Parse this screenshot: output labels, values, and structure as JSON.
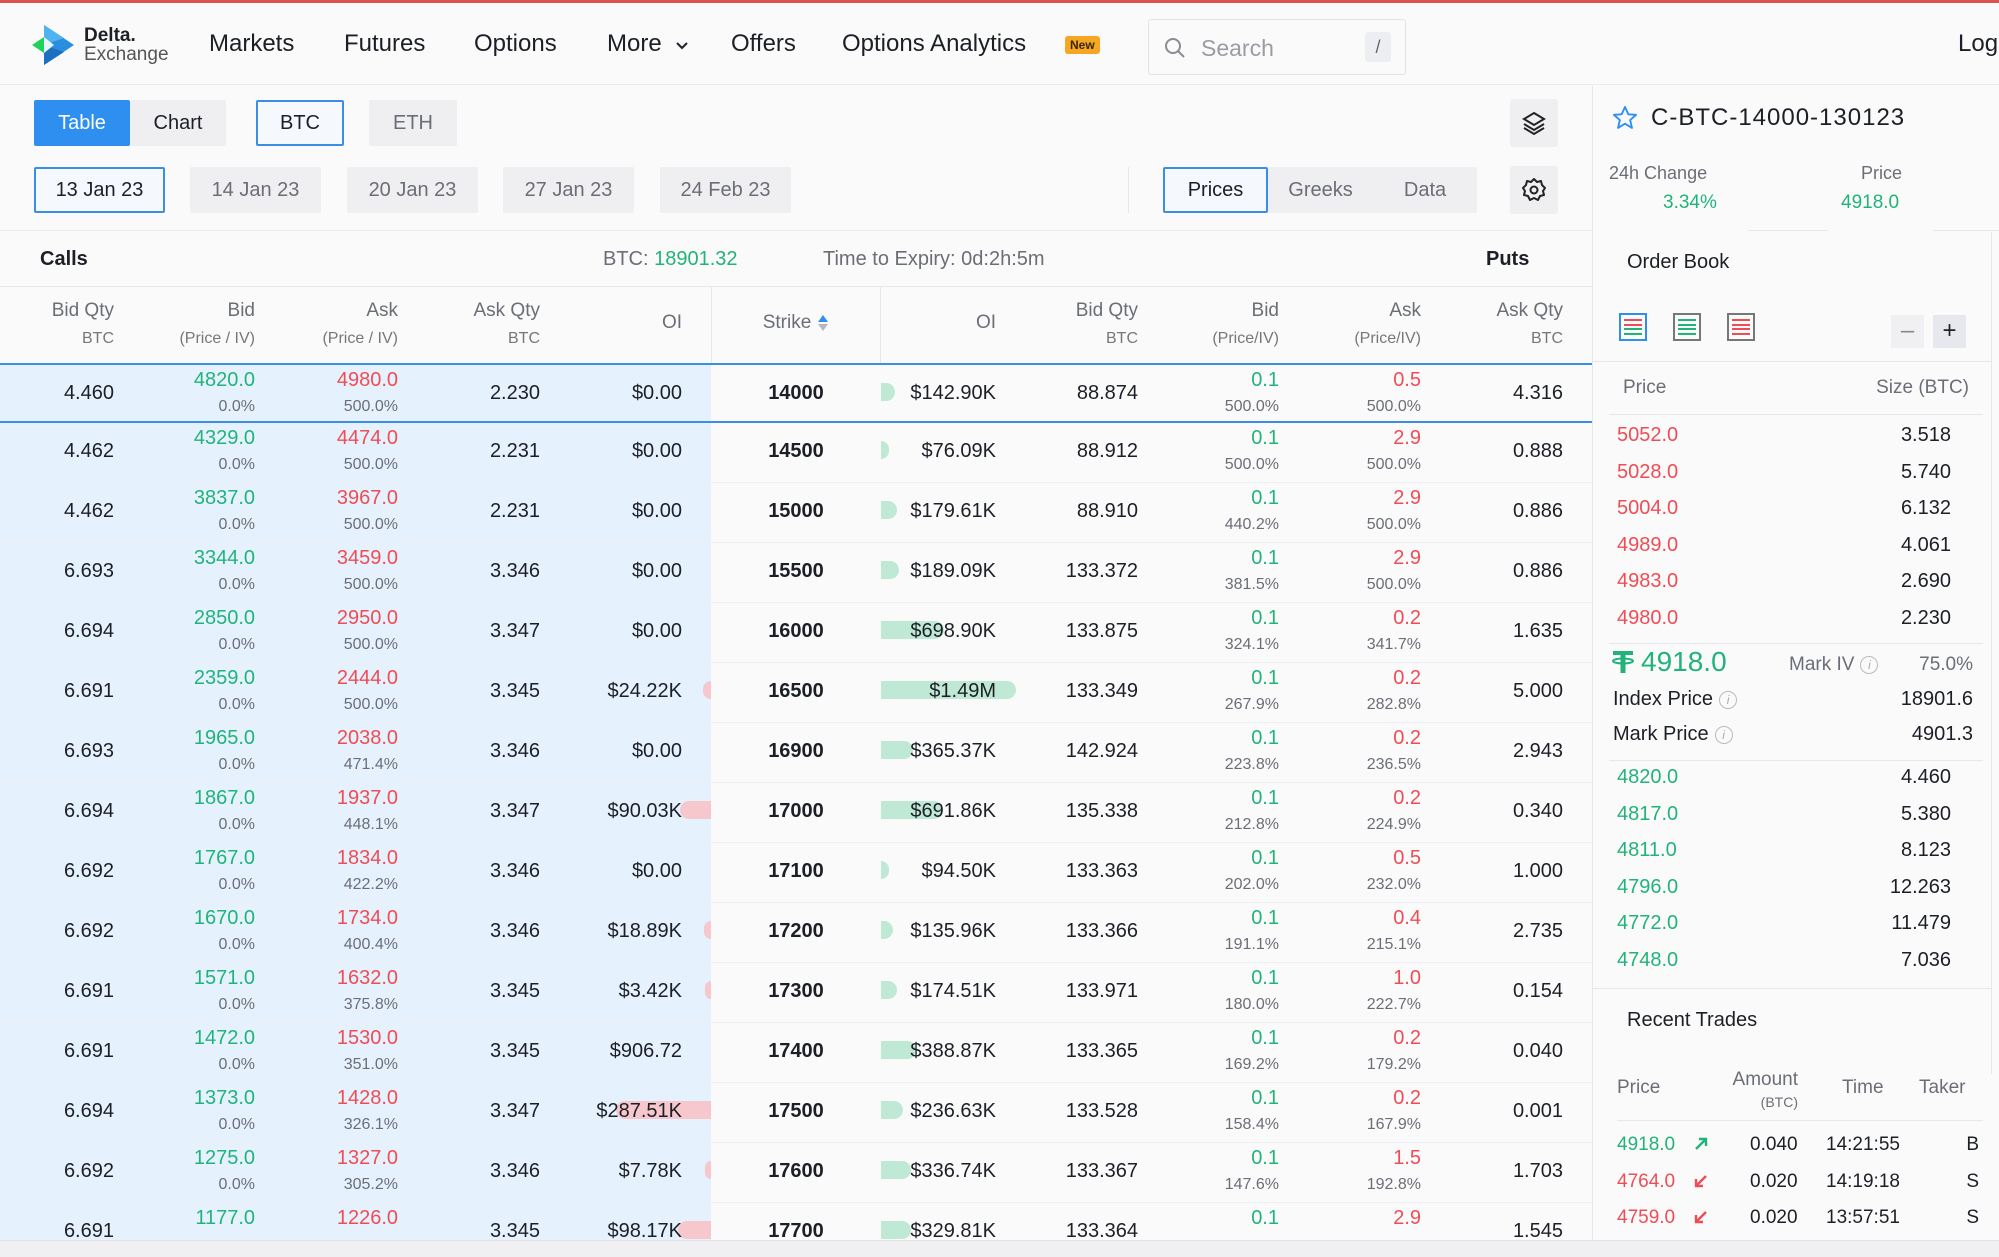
{
  "nav": {
    "brand_line1": "Delta.",
    "brand_line2": "Exchange",
    "items": [
      "Markets",
      "Futures",
      "Options",
      "More",
      "Offers",
      "Options Analytics"
    ],
    "new_badge": "New",
    "search_placeholder": "Search",
    "search_shortcut": "/",
    "login": "Log"
  },
  "toolbar": {
    "view_tabs": [
      "Table",
      "Chart"
    ],
    "assets": [
      "BTC",
      "ETH"
    ],
    "expiries": [
      "13 Jan 23",
      "14 Jan 23",
      "20 Jan 23",
      "27 Jan 23",
      "24 Feb 23"
    ],
    "modes": [
      "Prices",
      "Greeks",
      "Data"
    ]
  },
  "chain": {
    "calls_label": "Calls",
    "puts_label": "Puts",
    "btc_label": "BTC:",
    "btc_price": "18901.32",
    "expiry_label": "Time to Expiry: 0d:2h:5m",
    "headers_calls": [
      {
        "title": "Bid Qty",
        "sub": "BTC"
      },
      {
        "title": "Bid",
        "sub": "(Price / IV)"
      },
      {
        "title": "Ask",
        "sub": "(Price / IV)"
      },
      {
        "title": "Ask Qty",
        "sub": "BTC"
      },
      {
        "title": "OI",
        "sub": ""
      }
    ],
    "strike_header": "Strike",
    "headers_puts": [
      {
        "title": "OI",
        "sub": ""
      },
      {
        "title": "Bid Qty",
        "sub": "BTC"
      },
      {
        "title": "Bid",
        "sub": "(Price/IV)"
      },
      {
        "title": "Ask",
        "sub": "(Price/IV)"
      },
      {
        "title": "Ask Qty",
        "sub": "BTC"
      }
    ],
    "rows": [
      {
        "c_bidqty": "4.460",
        "c_bid": "4820.0",
        "c_bidiv": "0.0%",
        "c_ask": "4980.0",
        "c_askiv": "500.0%",
        "c_askqty": "2.230",
        "c_oi": "$0.00",
        "c_oi_frac": 0,
        "strike": "14000",
        "p_oi": "$142.90K",
        "p_oi_frac": 0.1,
        "p_bidqty": "88.874",
        "p_bid": "0.1",
        "p_bidiv": "500.0%",
        "p_ask": "0.5",
        "p_askiv": "500.0%",
        "p_askqty": "4.316"
      },
      {
        "c_bidqty": "4.462",
        "c_bid": "4329.0",
        "c_bidiv": "0.0%",
        "c_ask": "4474.0",
        "c_askiv": "500.0%",
        "c_askqty": "2.231",
        "c_oi": "$0.00",
        "c_oi_frac": 0,
        "strike": "14500",
        "p_oi": "$76.09K",
        "p_oi_frac": 0.05,
        "p_bidqty": "88.912",
        "p_bid": "0.1",
        "p_bidiv": "500.0%",
        "p_ask": "2.9",
        "p_askiv": "500.0%",
        "p_askqty": "0.888"
      },
      {
        "c_bidqty": "4.462",
        "c_bid": "3837.0",
        "c_bidiv": "0.0%",
        "c_ask": "3967.0",
        "c_askiv": "500.0%",
        "c_askqty": "2.231",
        "c_oi": "$0.00",
        "c_oi_frac": 0,
        "strike": "15000",
        "p_oi": "$179.61K",
        "p_oi_frac": 0.12,
        "p_bidqty": "88.910",
        "p_bid": "0.1",
        "p_bidiv": "440.2%",
        "p_ask": "2.9",
        "p_askiv": "500.0%",
        "p_askqty": "0.886"
      },
      {
        "c_bidqty": "6.693",
        "c_bid": "3344.0",
        "c_bidiv": "0.0%",
        "c_ask": "3459.0",
        "c_askiv": "500.0%",
        "c_askqty": "3.346",
        "c_oi": "$0.00",
        "c_oi_frac": 0,
        "strike": "15500",
        "p_oi": "$189.09K",
        "p_oi_frac": 0.13,
        "p_bidqty": "133.372",
        "p_bid": "0.1",
        "p_bidiv": "381.5%",
        "p_ask": "2.9",
        "p_askiv": "500.0%",
        "p_askqty": "0.886"
      },
      {
        "c_bidqty": "6.694",
        "c_bid": "2850.0",
        "c_bidiv": "0.0%",
        "c_ask": "2950.0",
        "c_askiv": "500.0%",
        "c_askqty": "3.347",
        "c_oi": "$0.00",
        "c_oi_frac": 0,
        "strike": "16000",
        "p_oi": "$698.90K",
        "p_oi_frac": 0.47,
        "p_bidqty": "133.875",
        "p_bid": "0.1",
        "p_bidiv": "324.1%",
        "p_ask": "0.2",
        "p_askiv": "341.7%",
        "p_askqty": "1.635"
      },
      {
        "c_bidqty": "6.691",
        "c_bid": "2359.0",
        "c_bidiv": "0.0%",
        "c_ask": "2444.0",
        "c_askiv": "500.0%",
        "c_askqty": "3.345",
        "c_oi": "$24.22K",
        "c_oi_frac": 0.08,
        "strike": "16500",
        "p_oi": "$1.49M",
        "p_oi_frac": 1.0,
        "p_bidqty": "133.349",
        "p_bid": "0.1",
        "p_bidiv": "267.9%",
        "p_ask": "0.2",
        "p_askiv": "282.8%",
        "p_askqty": "5.000"
      },
      {
        "c_bidqty": "6.693",
        "c_bid": "1965.0",
        "c_bidiv": "0.0%",
        "c_ask": "2038.0",
        "c_askiv": "471.4%",
        "c_askqty": "3.346",
        "c_oi": "$0.00",
        "c_oi_frac": 0,
        "strike": "16900",
        "p_oi": "$365.37K",
        "p_oi_frac": 0.24,
        "p_bidqty": "142.924",
        "p_bid": "0.1",
        "p_bidiv": "223.8%",
        "p_ask": "0.2",
        "p_askiv": "236.5%",
        "p_askqty": "2.943"
      },
      {
        "c_bidqty": "6.694",
        "c_bid": "1867.0",
        "c_bidiv": "0.0%",
        "c_ask": "1937.0",
        "c_askiv": "448.1%",
        "c_askqty": "3.347",
        "c_oi": "$90.03K",
        "c_oi_frac": 0.31,
        "strike": "17000",
        "p_oi": "$691.86K",
        "p_oi_frac": 0.46,
        "p_bidqty": "135.338",
        "p_bid": "0.1",
        "p_bidiv": "212.8%",
        "p_ask": "0.2",
        "p_askiv": "224.9%",
        "p_askqty": "0.340"
      },
      {
        "c_bidqty": "6.692",
        "c_bid": "1767.0",
        "c_bidiv": "0.0%",
        "c_ask": "1834.0",
        "c_askiv": "422.2%",
        "c_askqty": "3.346",
        "c_oi": "$0.00",
        "c_oi_frac": 0,
        "strike": "17100",
        "p_oi": "$94.50K",
        "p_oi_frac": 0.06,
        "p_bidqty": "133.363",
        "p_bid": "0.1",
        "p_bidiv": "202.0%",
        "p_ask": "0.5",
        "p_askiv": "232.0%",
        "p_askqty": "1.000"
      },
      {
        "c_bidqty": "6.692",
        "c_bid": "1670.0",
        "c_bidiv": "0.0%",
        "c_ask": "1734.0",
        "c_askiv": "400.4%",
        "c_askqty": "3.346",
        "c_oi": "$18.89K",
        "c_oi_frac": 0.07,
        "strike": "17200",
        "p_oi": "$135.96K",
        "p_oi_frac": 0.09,
        "p_bidqty": "133.366",
        "p_bid": "0.1",
        "p_bidiv": "191.1%",
        "p_ask": "0.4",
        "p_askiv": "215.1%",
        "p_askqty": "2.735"
      },
      {
        "c_bidqty": "6.691",
        "c_bid": "1571.0",
        "c_bidiv": "0.0%",
        "c_ask": "1632.0",
        "c_askiv": "375.8%",
        "c_askqty": "3.345",
        "c_oi": "$3.42K",
        "c_oi_frac": 0.04,
        "strike": "17300",
        "p_oi": "$174.51K",
        "p_oi_frac": 0.12,
        "p_bidqty": "133.971",
        "p_bid": "0.1",
        "p_bidiv": "180.0%",
        "p_ask": "1.0",
        "p_askiv": "222.7%",
        "p_askqty": "0.154"
      },
      {
        "c_bidqty": "6.691",
        "c_bid": "1472.0",
        "c_bidiv": "0.0%",
        "c_ask": "1530.0",
        "c_askiv": "351.0%",
        "c_askqty": "3.345",
        "c_oi": "$906.72",
        "c_oi_frac": 0,
        "strike": "17400",
        "p_oi": "$388.87K",
        "p_oi_frac": 0.26,
        "p_bidqty": "133.365",
        "p_bid": "0.1",
        "p_bidiv": "169.2%",
        "p_ask": "0.2",
        "p_askiv": "179.2%",
        "p_askqty": "0.040"
      },
      {
        "c_bidqty": "6.694",
        "c_bid": "1373.0",
        "c_bidiv": "0.0%",
        "c_ask": "1428.0",
        "c_askiv": "326.1%",
        "c_askqty": "3.347",
        "c_oi": "$287.51K",
        "c_oi_frac": 0.95,
        "strike": "17500",
        "p_oi": "$236.63K",
        "p_oi_frac": 0.16,
        "p_bidqty": "133.528",
        "p_bid": "0.1",
        "p_bidiv": "158.4%",
        "p_ask": "0.2",
        "p_askiv": "167.9%",
        "p_askqty": "0.001"
      },
      {
        "c_bidqty": "6.692",
        "c_bid": "1275.0",
        "c_bidiv": "0.0%",
        "c_ask": "1327.0",
        "c_askiv": "305.2%",
        "c_askqty": "3.346",
        "c_oi": "$7.78K",
        "c_oi_frac": 0.04,
        "strike": "17600",
        "p_oi": "$336.74K",
        "p_oi_frac": 0.22,
        "p_bidqty": "133.367",
        "p_bid": "0.1",
        "p_bidiv": "147.6%",
        "p_ask": "1.5",
        "p_askiv": "192.8%",
        "p_askqty": "1.703"
      },
      {
        "c_bidqty": "6.691",
        "c_bid": "1177.0",
        "c_bidiv": "",
        "c_ask": "1226.0",
        "c_askiv": "",
        "c_askqty": "3.345",
        "c_oi": "$98.17K",
        "c_oi_frac": 0.33,
        "strike": "17700",
        "p_oi": "$329.81K",
        "p_oi_frac": 0.22,
        "p_bidqty": "133.364",
        "p_bid": "0.1",
        "p_bidiv": "",
        "p_ask": "2.9",
        "p_askiv": "",
        "p_askqty": "1.545"
      }
    ]
  },
  "panel": {
    "symbol": "C-BTC-14000-130123",
    "change_label": "24h Change",
    "change_value": "3.34%",
    "price_label": "Price",
    "price_value": "4918.0",
    "orderbook_title": "Order Book",
    "ob_col_price": "Price",
    "ob_col_size": "Size (BTC)",
    "asks": [
      {
        "price": "5052.0",
        "size": "3.518"
      },
      {
        "price": "5028.0",
        "size": "5.740"
      },
      {
        "price": "5004.0",
        "size": "6.132"
      },
      {
        "price": "4989.0",
        "size": "4.061"
      },
      {
        "price": "4983.0",
        "size": "2.690"
      },
      {
        "price": "4980.0",
        "size": "2.230"
      }
    ],
    "last_price": "4918.0",
    "mark_iv_label": "Mark IV",
    "mark_iv_value": "75.0%",
    "index_price_label": "Index Price",
    "index_price_value": "18901.6",
    "mark_price_label": "Mark Price",
    "mark_price_value": "4901.3",
    "bids": [
      {
        "price": "4820.0",
        "size": "4.460"
      },
      {
        "price": "4817.0",
        "size": "5.380"
      },
      {
        "price": "4811.0",
        "size": "8.123"
      },
      {
        "price": "4796.0",
        "size": "12.263"
      },
      {
        "price": "4772.0",
        "size": "11.479"
      },
      {
        "price": "4748.0",
        "size": "7.036"
      }
    ],
    "trades_title": "Recent Trades",
    "trades_cols": {
      "price": "Price",
      "amount": "Amount",
      "amount_sub": "(BTC)",
      "time": "Time",
      "taker": "Taker"
    },
    "trades": [
      {
        "price": "4918.0",
        "dir": "up",
        "amount": "0.040",
        "time": "14:21:55",
        "taker": "B"
      },
      {
        "price": "4764.0",
        "dir": "down",
        "amount": "0.020",
        "time": "14:19:18",
        "taker": "S"
      },
      {
        "price": "4759.0",
        "dir": "down",
        "amount": "0.020",
        "time": "13:57:51",
        "taker": "S"
      }
    ]
  },
  "colors": {
    "green": "#22b37a",
    "red": "#ef4d55",
    "accent": "#2e8ff0",
    "new_badge": "#f5a623"
  }
}
